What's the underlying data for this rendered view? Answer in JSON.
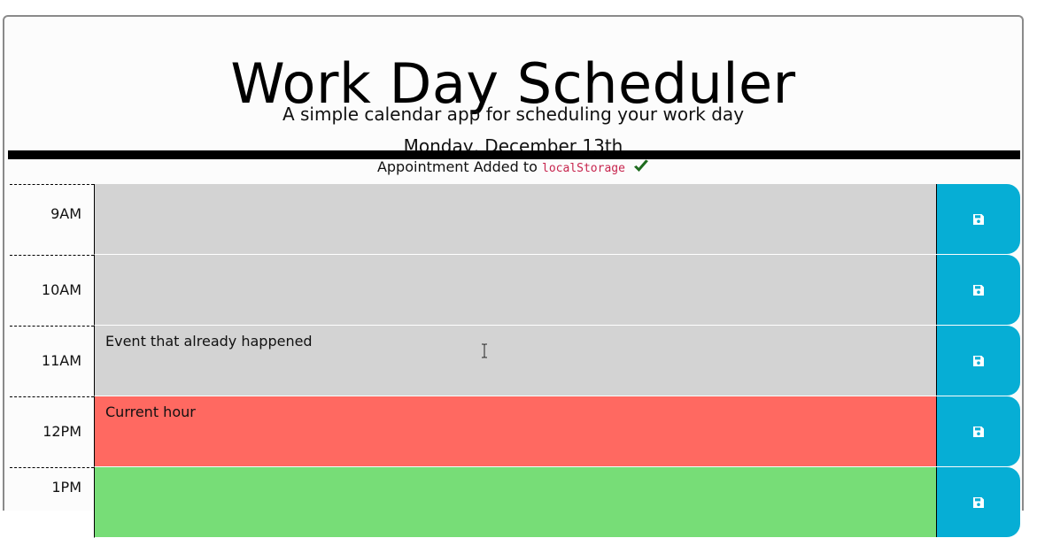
{
  "header": {
    "title": "Work Day Scheduler",
    "lead": "A simple calendar app for scheduling your work day",
    "current_day": "Monday, December 13th"
  },
  "notice": {
    "text": "Appointment Added to",
    "code": "localStorage",
    "icon": "check-icon",
    "icon_color": "#1e6b1e"
  },
  "colors": {
    "past": "#d3d3d3",
    "present": "#ff6961",
    "future": "#77dd77",
    "save_button": "#06aed5"
  },
  "timeblocks": [
    {
      "hour": "9AM",
      "event": "",
      "state": "past"
    },
    {
      "hour": "10AM",
      "event": "",
      "state": "past"
    },
    {
      "hour": "11AM",
      "event": "Event that already happened",
      "state": "past"
    },
    {
      "hour": "12PM",
      "event": "Current hour",
      "state": "present"
    },
    {
      "hour": "1PM",
      "event": "",
      "state": "future"
    }
  ],
  "save_icon": "save-icon"
}
